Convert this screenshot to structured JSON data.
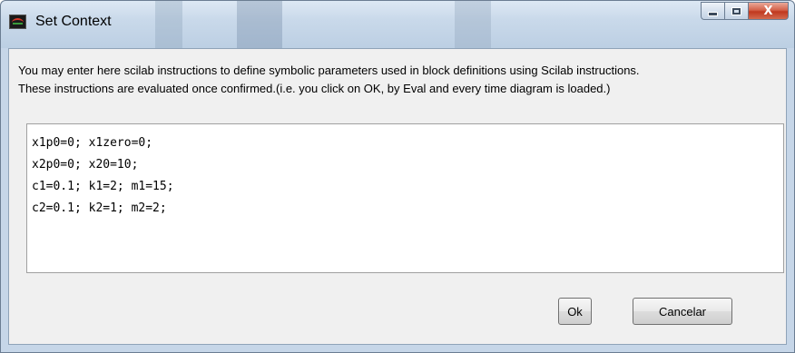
{
  "window": {
    "title": "Set Context"
  },
  "description": {
    "line1": "You may enter here scilab instructions to define symbolic parameters used in block definitions using Scilab instructions.",
    "line2": "These instructions are evaluated once confirmed.(i.e. you click on OK, by Eval and every time diagram is loaded.)"
  },
  "editor": {
    "lines": [
      "x1p0=0; x1zero=0;",
      "x2p0=0; x20=10;",
      "c1=0.1; k1=2; m1=15;",
      "c2=0.1; k2=1; m2=2;"
    ]
  },
  "buttons": {
    "ok_label": "Ok",
    "cancel_label": "Cancelar"
  },
  "caption_buttons": {
    "close_glyph": "X"
  },
  "colors": {
    "titlebar": "#c9d9ea",
    "close_button": "#c0381f",
    "app_icon_wave": "#d83a2a"
  },
  "icons": [
    "scilab-app-icon",
    "minimize-icon",
    "maximize-icon",
    "close-icon"
  ]
}
